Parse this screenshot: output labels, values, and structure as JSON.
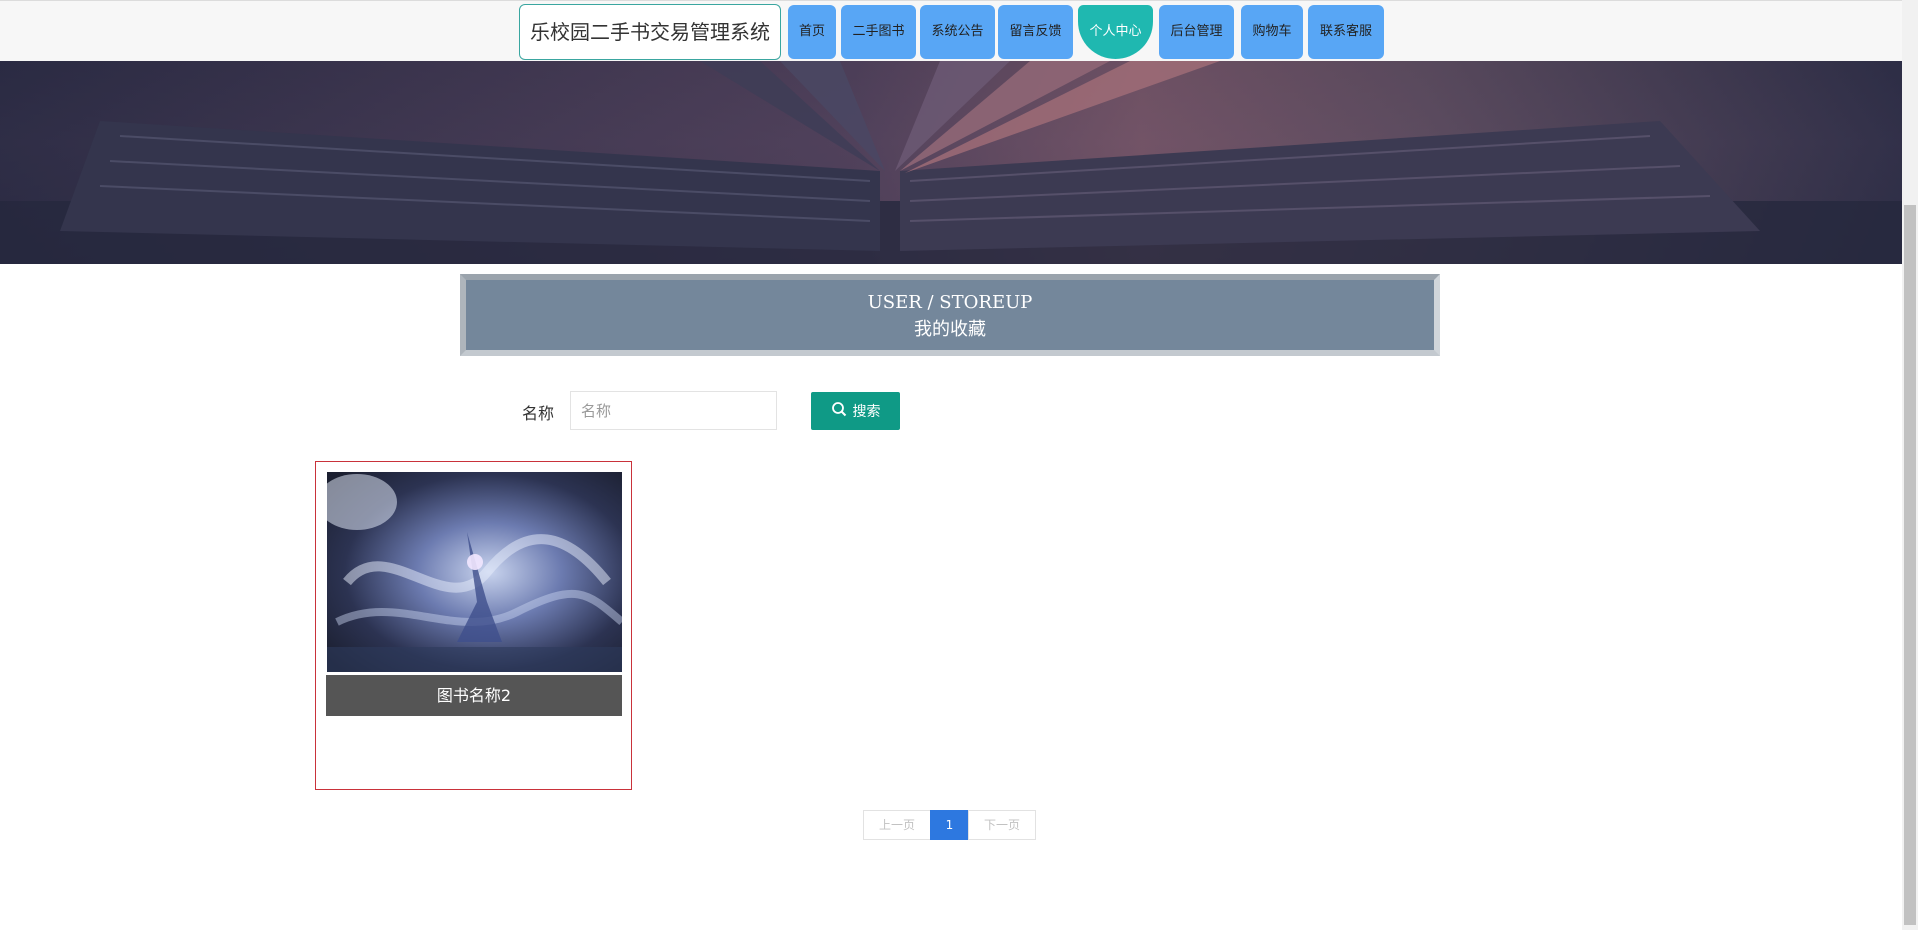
{
  "header": {
    "brand": "乐校园二手书交易管理系统",
    "nav": [
      {
        "label": "首页"
      },
      {
        "label": "二手图书"
      },
      {
        "label": "系统公告"
      },
      {
        "label": "留言反馈"
      },
      {
        "label": "个人中心",
        "active": true
      },
      {
        "label": "后台管理"
      },
      {
        "label": "购物车"
      },
      {
        "label": "联系客服"
      }
    ]
  },
  "section": {
    "title_en": "USER / STOREUP",
    "title_zh": "我的收藏"
  },
  "search": {
    "label": "名称",
    "placeholder": "名称",
    "value": "",
    "button_label": "搜索",
    "button_icon": "search-icon"
  },
  "items": [
    {
      "name": "图书名称2"
    }
  ],
  "pagination": {
    "prev": "上一页",
    "current": "1",
    "next": "下一页"
  },
  "colors": {
    "nav_button": "#58a6f5",
    "nav_active": "#1fb8b0",
    "section_bg": "#74879b",
    "search_button": "#0f9a86",
    "card_border": "#c9323a",
    "pager_current": "#2d78e0"
  }
}
